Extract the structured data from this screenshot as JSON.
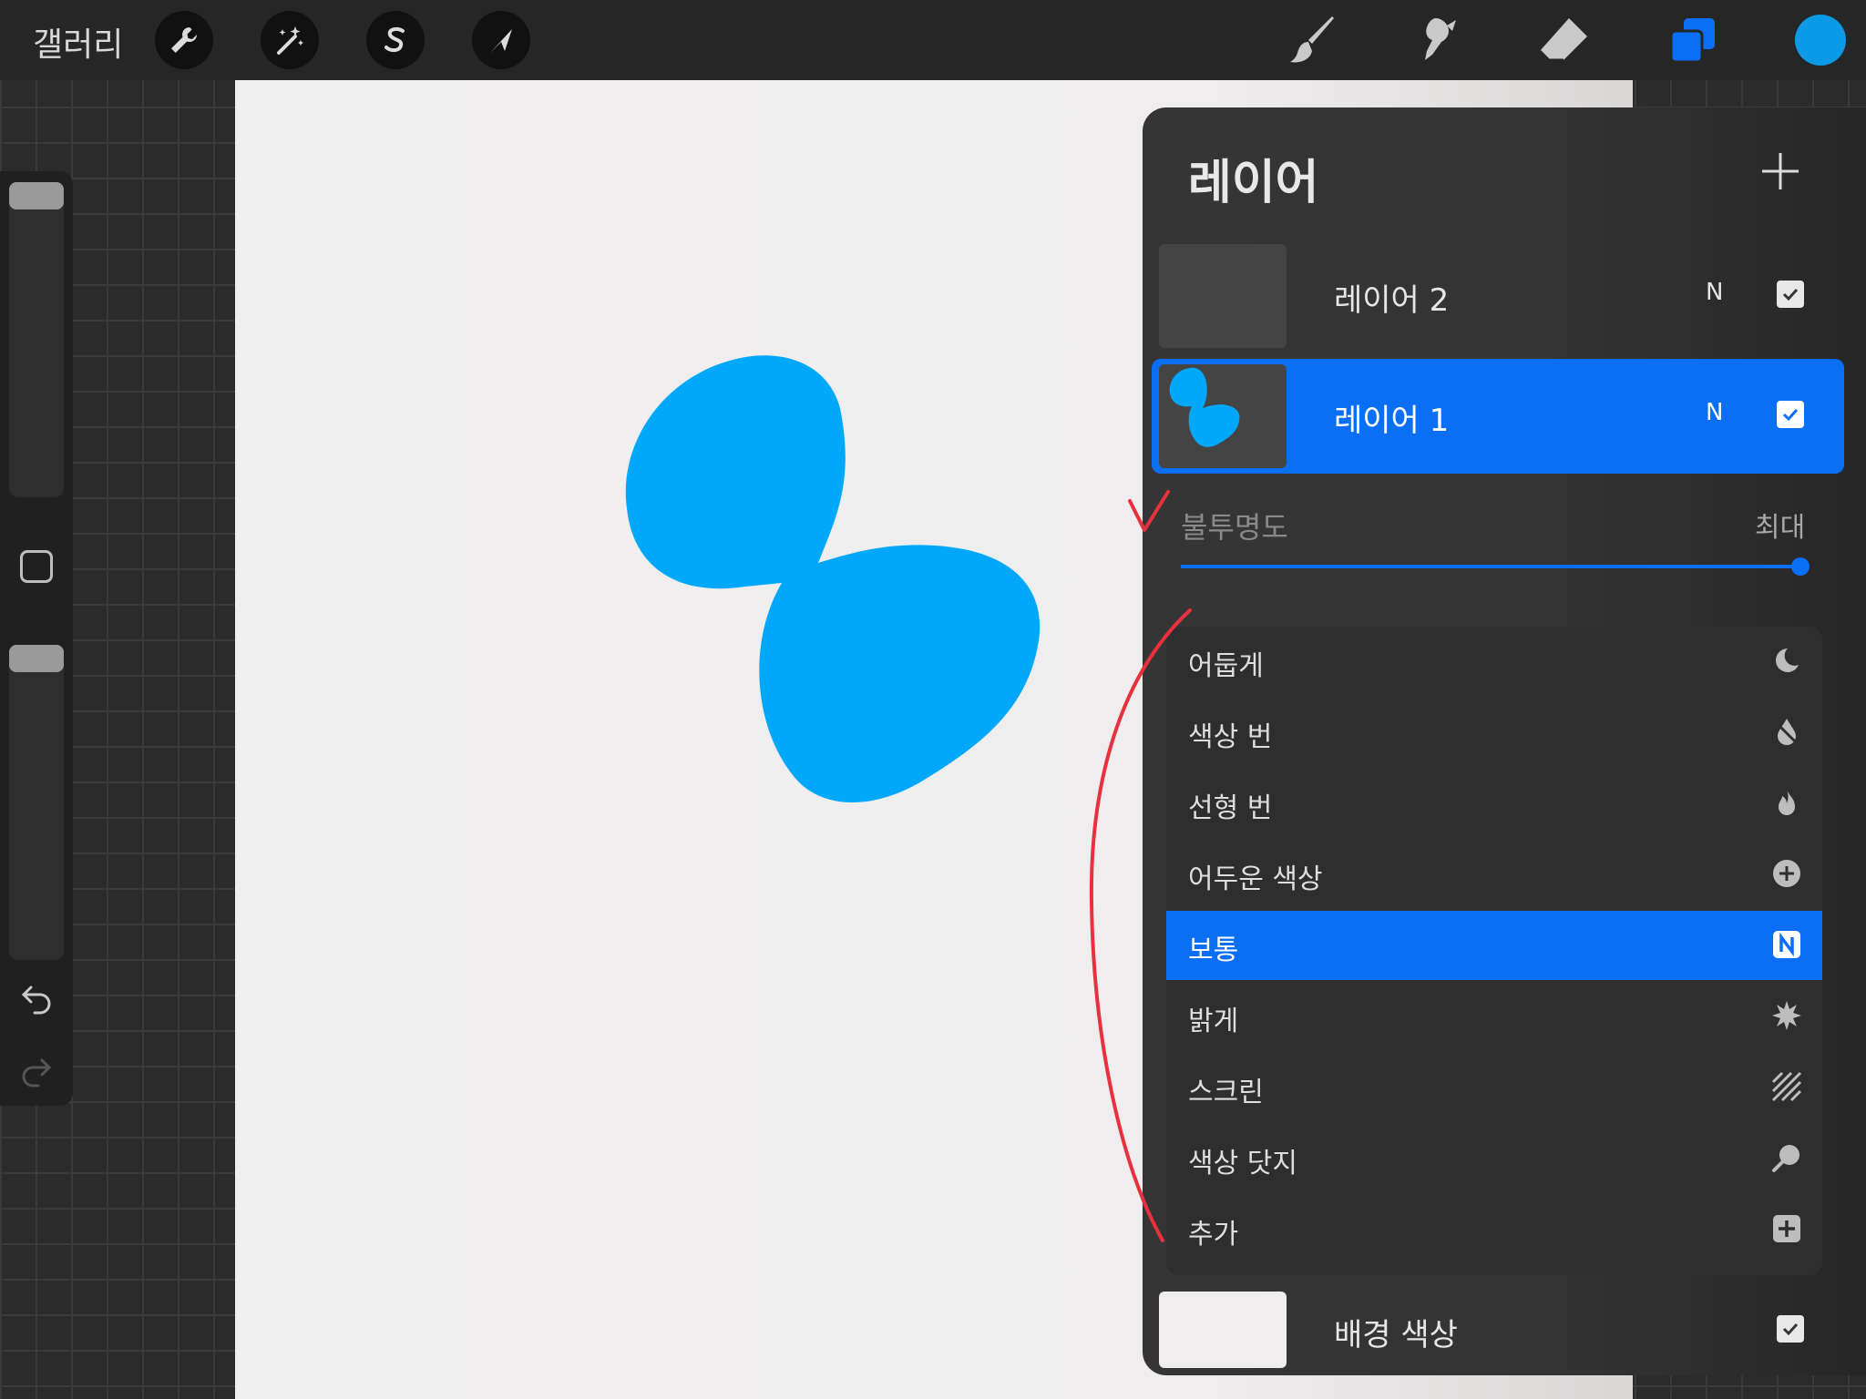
{
  "topbar": {
    "gallery_label": "갤러리",
    "left_tools": [
      "wrench-icon",
      "magic-wand-icon",
      "selection-s-icon",
      "transform-arrow-icon"
    ],
    "right_tools": [
      "brush-icon",
      "smudge-icon",
      "eraser-icon",
      "layers-icon"
    ],
    "current_color": "#0a9ae8"
  },
  "sidebar": {
    "brush_size_level": 0.95,
    "opacity_level": 0.95,
    "undo_icon": "undo-icon",
    "redo_icon": "redo-icon"
  },
  "layers_panel": {
    "title": "레이어",
    "add_icon": "plus-icon",
    "layers": [
      {
        "name": "레이어 2",
        "mode": "N",
        "visible": true,
        "selected": false
      },
      {
        "name": "레이어 1",
        "mode": "N",
        "visible": true,
        "selected": true
      }
    ],
    "opacity": {
      "label": "불투명도",
      "value": "최대",
      "level": 1.0
    },
    "blend_modes": [
      {
        "label": "어둡게",
        "icon": "moon-icon"
      },
      {
        "label": "색상 번",
        "icon": "burn-drop-icon"
      },
      {
        "label": "선형 번",
        "icon": "flame-icon"
      },
      {
        "label": "어두운 색상",
        "icon": "plus-circle-icon"
      },
      {
        "label": "보통",
        "icon": "n-badge-icon",
        "active": true
      },
      {
        "label": "밝게",
        "icon": "sparkle-icon"
      },
      {
        "label": "스크린",
        "icon": "hatch-icon"
      },
      {
        "label": "색상 닷지",
        "icon": "dodge-icon"
      },
      {
        "label": "추가",
        "icon": "plus-square-icon"
      }
    ],
    "background": {
      "name": "배경 색상",
      "visible": true
    }
  },
  "colors": {
    "accent": "#0b6ff5",
    "shape_fill": "#00a8fb",
    "annotation": "#e8313f"
  }
}
